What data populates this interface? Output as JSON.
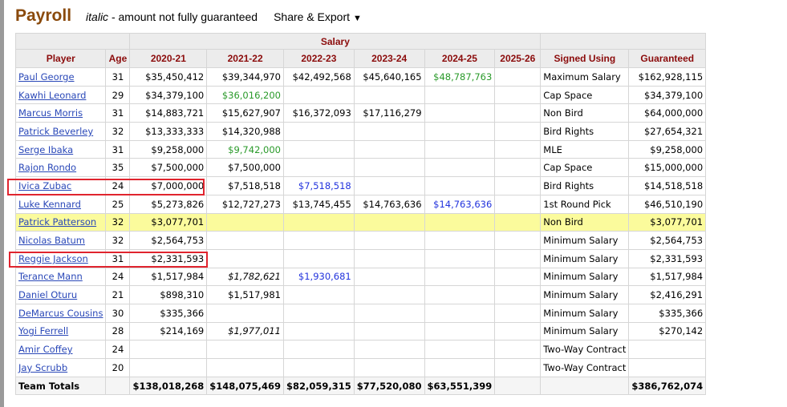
{
  "header": {
    "title": "Payroll",
    "note_italic": "italic",
    "note_rest": " - amount not fully guaranteed",
    "share_label": "Share & Export",
    "share_caret": "▼"
  },
  "table": {
    "group_header": "Salary",
    "columns": [
      "Player",
      "Age",
      "2020-21",
      "2021-22",
      "2022-23",
      "2023-24",
      "2024-25",
      "2025-26",
      "Signed Using",
      "Guaranteed"
    ],
    "rows": [
      {
        "player": "Paul George",
        "age": "31",
        "s": [
          "$35,450,412",
          "$39,344,970",
          "$42,492,568",
          "$45,640,165",
          "$48,787,763",
          ""
        ],
        "signed": "Maximum Salary",
        "guaranteed": "$162,928,115"
      },
      {
        "player": "Kawhi Leonard",
        "age": "29",
        "s": [
          "$34,379,100",
          "$36,016,200",
          "",
          "",
          "",
          ""
        ],
        "signed": "Cap Space",
        "guaranteed": "$34,379,100"
      },
      {
        "player": "Marcus Morris",
        "age": "31",
        "s": [
          "$14,883,721",
          "$15,627,907",
          "$16,372,093",
          "$17,116,279",
          "",
          ""
        ],
        "signed": "Non Bird",
        "guaranteed": "$64,000,000"
      },
      {
        "player": "Patrick Beverley",
        "age": "32",
        "s": [
          "$13,333,333",
          "$14,320,988",
          "",
          "",
          "",
          ""
        ],
        "signed": "Bird Rights",
        "guaranteed": "$27,654,321"
      },
      {
        "player": "Serge Ibaka",
        "age": "31",
        "s": [
          "$9,258,000",
          "$9,742,000",
          "",
          "",
          "",
          ""
        ],
        "signed": "MLE",
        "guaranteed": "$9,258,000"
      },
      {
        "player": "Rajon Rondo",
        "age": "35",
        "s": [
          "$7,500,000",
          "$7,500,000",
          "",
          "",
          "",
          ""
        ],
        "signed": "Cap Space",
        "guaranteed": "$15,000,000"
      },
      {
        "player": "Ivica Zubac",
        "age": "24",
        "s": [
          "$7,000,000",
          "$7,518,518",
          "$7,518,518",
          "",
          "",
          ""
        ],
        "signed": "Bird Rights",
        "guaranteed": "$14,518,518"
      },
      {
        "player": "Luke Kennard",
        "age": "25",
        "s": [
          "$5,273,826",
          "$12,727,273",
          "$13,745,455",
          "$14,763,636",
          "$14,763,636",
          ""
        ],
        "signed": "1st Round Pick",
        "guaranteed": "$46,510,190"
      },
      {
        "player": "Patrick Patterson",
        "age": "32",
        "s": [
          "$3,077,701",
          "",
          "",
          "",
          "",
          ""
        ],
        "signed": "Non Bird",
        "guaranteed": "$3,077,701"
      },
      {
        "player": "Nicolas Batum",
        "age": "32",
        "s": [
          "$2,564,753",
          "",
          "",
          "",
          "",
          ""
        ],
        "signed": "Minimum Salary",
        "guaranteed": "$2,564,753"
      },
      {
        "player": "Reggie Jackson",
        "age": "31",
        "s": [
          "$2,331,593",
          "",
          "",
          "",
          "",
          ""
        ],
        "signed": "Minimum Salary",
        "guaranteed": "$2,331,593"
      },
      {
        "player": "Terance Mann",
        "age": "24",
        "s": [
          "$1,517,984",
          "$1,782,621",
          "$1,930,681",
          "",
          "",
          ""
        ],
        "signed": "Minimum Salary",
        "guaranteed": "$1,517,984"
      },
      {
        "player": "Daniel Oturu",
        "age": "21",
        "s": [
          "$898,310",
          "$1,517,981",
          "",
          "",
          "",
          ""
        ],
        "signed": "Minimum Salary",
        "guaranteed": "$2,416,291"
      },
      {
        "player": "DeMarcus Cousins",
        "age": "30",
        "s": [
          "$335,366",
          "",
          "",
          "",
          "",
          ""
        ],
        "signed": "Minimum Salary",
        "guaranteed": "$335,366"
      },
      {
        "player": "Yogi Ferrell",
        "age": "28",
        "s": [
          "$214,169",
          "$1,977,011",
          "",
          "",
          "",
          ""
        ],
        "signed": "Minimum Salary",
        "guaranteed": "$270,142"
      },
      {
        "player": "Amir Coffey",
        "age": "24",
        "s": [
          "",
          "",
          "",
          "",
          "",
          ""
        ],
        "signed": "Two-Way Contract",
        "guaranteed": ""
      },
      {
        "player": "Jay Scrubb",
        "age": "20",
        "s": [
          "",
          "",
          "",
          "",
          "",
          ""
        ],
        "signed": "Two-Way Contract",
        "guaranteed": ""
      }
    ],
    "totals": {
      "label": "Team Totals",
      "s": [
        "$138,018,268",
        "$148,075,469",
        "$82,059,315",
        "$77,520,080",
        "$63,551,399",
        ""
      ],
      "guaranteed": "$386,762,074"
    }
  },
  "colors": {
    "title": "#8a4a0c",
    "header_text": "#8b0b0b",
    "player_link": "#2a48b8",
    "player_option": "#2a9a2a",
    "team_option": "#2233dd",
    "highlight_row": "#fbfb9c",
    "annotation_box": "#e0242e"
  }
}
